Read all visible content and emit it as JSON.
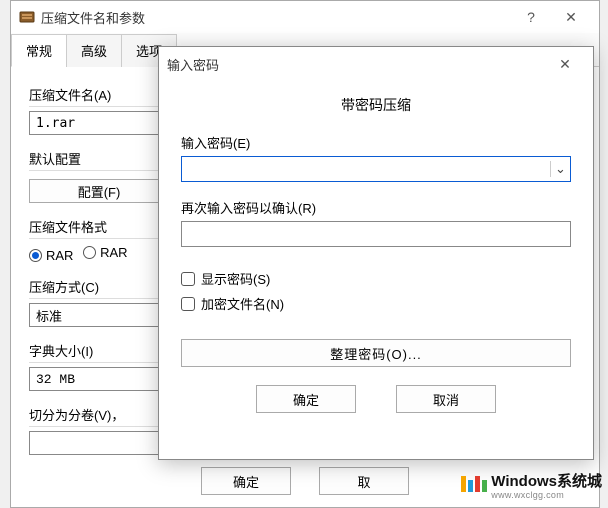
{
  "main": {
    "title": "压缩文件名和参数",
    "tabs": [
      "常规",
      "高级",
      "选项"
    ],
    "filename_label": "压缩文件名(A)",
    "filename_value": "1.rar",
    "profile_label": "默认配置",
    "profile_button": "配置(F)",
    "format_label": "压缩文件格式",
    "radio_rar": "RAR",
    "radio_rar5": "RAR",
    "method_label": "压缩方式(C)",
    "method_value": "标准",
    "dict_label": "字典大小(I)",
    "dict_value": "32 MB",
    "split_label": "切分为分卷(V)，",
    "ok": "确定",
    "cancel": "取"
  },
  "overlay": {
    "title": "输入密码",
    "section": "带密码压缩",
    "password_label": "输入密码(E)",
    "confirm_label": "再次输入密码以确认(R)",
    "show_password": "显示密码(S)",
    "encrypt_names": "加密文件名(N)",
    "organize": "整理密码(O)...",
    "ok": "确定",
    "cancel": "取消"
  },
  "watermark": {
    "brand": "Windows系统城",
    "url": "www.wxclgg.com"
  }
}
